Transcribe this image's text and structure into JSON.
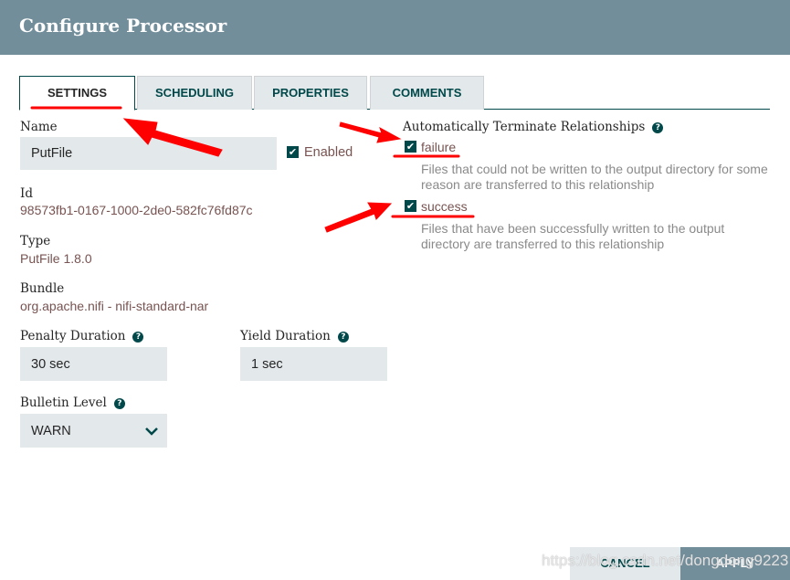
{
  "header": {
    "title": "Configure Processor"
  },
  "tabs": [
    {
      "label": "SETTINGS",
      "active": true
    },
    {
      "label": "SCHEDULING"
    },
    {
      "label": "PROPERTIES"
    },
    {
      "label": "COMMENTS"
    }
  ],
  "settings": {
    "name_label": "Name",
    "name_value": "PutFile",
    "enabled_label": "Enabled",
    "enabled": true,
    "id_label": "Id",
    "id_value": "98573fb1-0167-1000-2de0-582fc76fd87c",
    "type_label": "Type",
    "type_value": "PutFile 1.8.0",
    "bundle_label": "Bundle",
    "bundle_value": "org.apache.nifi - nifi-standard-nar",
    "penalty_label": "Penalty Duration",
    "penalty_value": "30 sec",
    "yield_label": "Yield Duration",
    "yield_value": "1 sec",
    "bulletin_label": "Bulletin Level",
    "bulletin_value": "WARN"
  },
  "relationships": {
    "title": "Automatically Terminate Relationships",
    "items": [
      {
        "name": "failure",
        "checked": true,
        "description": "Files that could not be written to the output directory for some reason are transferred to this relationship"
      },
      {
        "name": "success",
        "checked": true,
        "description": "Files that have been successfully written to the output directory are transferred to this relationship"
      }
    ]
  },
  "footer": {
    "cancel": "CANCEL",
    "apply": "APPLY"
  },
  "watermark": "https://blog.csdn.net/dongdong9223",
  "colors": {
    "header": "#728e9b",
    "accent": "#004849",
    "value": "#775351",
    "annotation": "#ff0000"
  }
}
